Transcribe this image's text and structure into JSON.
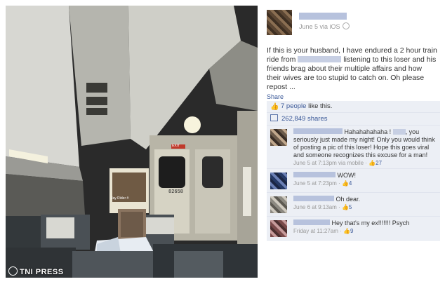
{
  "watermark": "TNI PRESS",
  "post": {
    "meta": "June 5 via iOS",
    "text_before": "If this is your husband, I have endured a 2 hour train ride from",
    "text_after": "listening to this loser and his friends brag about their multiple affairs and how their wives are too stupid to catch on. Oh please repost ...",
    "share_label": "Share"
  },
  "likes": {
    "link": "7 people",
    "rest": " like this."
  },
  "shares": {
    "count": "262,849 shares"
  },
  "comments": [
    {
      "text_a": "Hahahahahaha !",
      "text_b": ", you seriously just made my night! Only you would think of posting a pic of this loser! Hope this goes viral and someone recognizes this excuse for a man!",
      "meta": "June 5 at 7:13pm via mobile · ",
      "likes": "27"
    },
    {
      "text_a": "WOW!",
      "text_b": "",
      "meta": "June 5 at 7:23pm · ",
      "likes": "4"
    },
    {
      "text_a": "Oh dear.",
      "text_b": "",
      "meta": "June 6 at 9:13am · ",
      "likes": "5"
    },
    {
      "text_a": "Hey that's my ex!!!!!!! Psych",
      "text_b": "",
      "meta": "Friday at 11:27am · ",
      "likes": "9"
    }
  ],
  "photo": {
    "poster_text": "Jay Rider #",
    "car_number": "82658",
    "door_sign": "EXIT"
  }
}
